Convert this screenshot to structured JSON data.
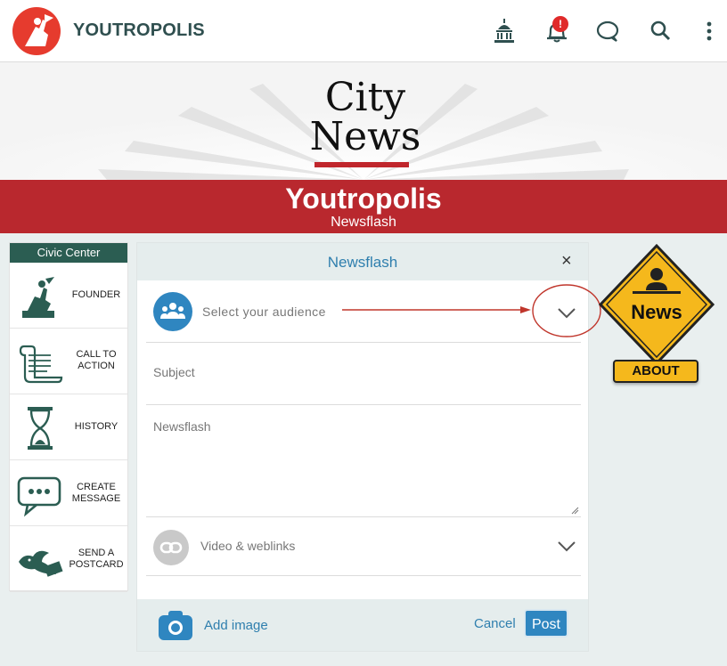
{
  "app": {
    "brand": "YOUTROPOLIS",
    "notification_count": "!"
  },
  "banner": {
    "city_line1": "City",
    "city_line2": "News",
    "title": "Youtropolis",
    "subtitle": "Newsflash"
  },
  "sidebar": {
    "header": "Civic Center",
    "items": [
      {
        "label": "FOUNDER",
        "icon": "founder-statue-icon"
      },
      {
        "label": "CALL TO ACTION",
        "icon": "scroll-icon"
      },
      {
        "label": "HISTORY",
        "icon": "hourglass-icon"
      },
      {
        "label": "CREATE MESSAGE",
        "icon": "chat-bubble-icon"
      },
      {
        "label": "SEND A POSTCARD",
        "icon": "bird-postcard-icon"
      }
    ]
  },
  "dialog": {
    "title": "Newsflash",
    "close": "×",
    "audience_placeholder": "Select your audience",
    "subject_placeholder": "Subject",
    "body_placeholder": "Newsflash",
    "video_label": "Video & weblinks",
    "add_image": "Add image",
    "cancel": "Cancel",
    "post": "Post"
  },
  "news_sign": {
    "word": "News",
    "about": "ABOUT"
  },
  "colors": {
    "accent_blue": "#2f86c0",
    "brand_red": "#b9282e",
    "sidebar_green": "#2b5d52",
    "sign_yellow": "#f5b81c"
  }
}
